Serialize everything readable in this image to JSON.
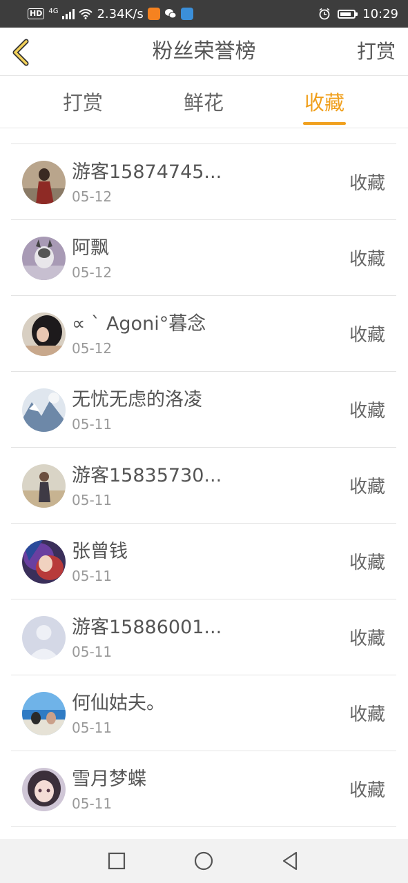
{
  "status_bar": {
    "network_badge": "HD",
    "network_type": "4G",
    "speed": "2.34K/s",
    "time": "10:29",
    "icons": [
      "signal-icon",
      "wifi-icon",
      "video-app-icon",
      "wechat-icon",
      "browser-app-icon",
      "alarm-icon",
      "battery-icon"
    ]
  },
  "nav": {
    "title": "粉丝荣誉榜",
    "action_label": "打赏"
  },
  "tabs": [
    {
      "label": "打赏",
      "active": false
    },
    {
      "label": "鲜花",
      "active": false
    },
    {
      "label": "收藏",
      "active": true
    }
  ],
  "accent_color": "#f0a01e",
  "list": [
    {
      "name": "游客15874745...",
      "date": "05-12",
      "action": "收藏"
    },
    {
      "name": "阿飘",
      "date": "05-12",
      "action": "收藏"
    },
    {
      "name": "∝ ˋ Agoni°暮念",
      "date": "05-12",
      "action": "收藏"
    },
    {
      "name": "无忧无虑的洛凌",
      "date": "05-11",
      "action": "收藏"
    },
    {
      "name": "游客15835730...",
      "date": "05-11",
      "action": "收藏"
    },
    {
      "name": "张曾钱",
      "date": "05-11",
      "action": "收藏"
    },
    {
      "name": "游客15886001...",
      "date": "05-11",
      "action": "收藏"
    },
    {
      "name": "何仙姑夫。",
      "date": "05-11",
      "action": "收藏"
    },
    {
      "name": "雪月梦蝶",
      "date": "05-11",
      "action": "收藏"
    }
  ]
}
